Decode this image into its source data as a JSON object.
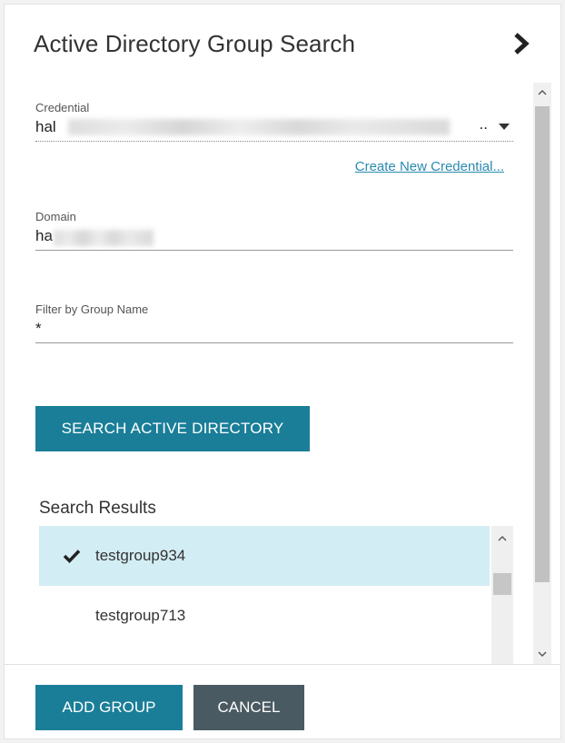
{
  "panel": {
    "title": "Active Directory Group Search"
  },
  "credential": {
    "label": "Credential",
    "value": "hal",
    "ellipsis": ".."
  },
  "create_credential_link": "Create New Credential...",
  "domain": {
    "label": "Domain",
    "value": "ha"
  },
  "filter": {
    "label": "Filter by Group Name",
    "value": "*"
  },
  "search_button": "SEARCH ACTIVE DIRECTORY",
  "results": {
    "heading": "Search Results",
    "items": [
      {
        "label": "testgroup934",
        "selected": true
      },
      {
        "label": "testgroup713",
        "selected": false
      }
    ]
  },
  "footer": {
    "add_label": "ADD GROUP",
    "cancel_label": "CANCEL"
  },
  "colors": {
    "primary_button": "#1a7e98",
    "secondary_button": "#4a5a62",
    "link": "#2a8ab0",
    "selected_row": "#d3edf4"
  },
  "icons": [
    "chevron-right-icon",
    "dropdown-caret-icon",
    "checkmark-icon",
    "scroll-up-icon",
    "scroll-down-icon"
  ]
}
